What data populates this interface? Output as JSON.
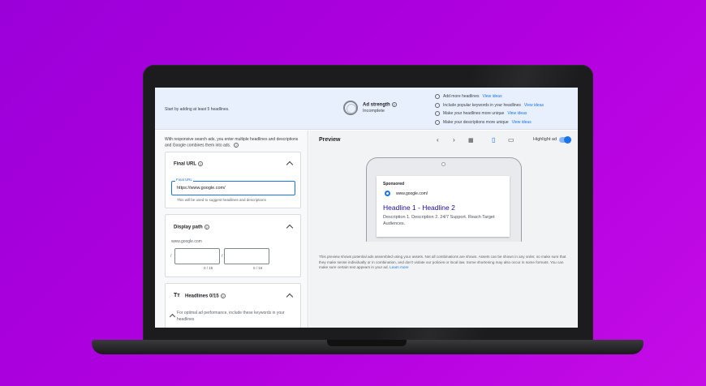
{
  "top_bar": {
    "hint": "Start by adding at least 5 headlines.",
    "ad_strength_title": "Ad strength",
    "ad_strength_status": "Incomplete",
    "suggestions": [
      {
        "text": "Add more headlines",
        "link": "View ideas"
      },
      {
        "text": "Include popular keywords in your headlines",
        "link": "View ideas"
      },
      {
        "text": "Make your headlines more unique",
        "link": "View ideas"
      },
      {
        "text": "Make your descriptions more unique",
        "link": "View ideas"
      }
    ]
  },
  "left": {
    "intro": "With responsive search ads, you enter multiple headlines and descriptions and Google combines them into ads.",
    "final_url": {
      "title": "Final URL",
      "label": "Final URL",
      "value": "https://www.google.com/",
      "help": "This will be used to suggest headlines and descriptions"
    },
    "display_path": {
      "title": "Display path",
      "domain": "www.google.com",
      "slash1": "/",
      "slash2": "/",
      "counter1": "0 / 15",
      "counter2": "0 / 15"
    },
    "headlines": {
      "icon": "Tт",
      "title": "Headlines 0/15",
      "tip": "For optimal ad performance, include these keywords in your headlines"
    }
  },
  "preview": {
    "title": "Preview",
    "highlight_label": "Highlight ad",
    "toolbar_icons": {
      "prev": "‹",
      "next": "›",
      "grid": "▦",
      "mobile": "▯",
      "desktop": "▭"
    },
    "ad": {
      "sponsored": "Sponsored",
      "url": "www.google.com/",
      "headline": "Headline 1 - Headline 2",
      "description": "Description 1. Description 2. 24/7 Support. Reach Target Audiences."
    },
    "disclaimer": "This preview shows potential ads assembled using your assets. Not all combinations are shown. Assets can be shown in any order, so make sure that they make sense individually or in combination, and don't violate our policies or local law. Some shortening may also occur in some formats. You can make sure certain text appears in your ad.",
    "learn_more": "Learn more"
  },
  "colors": {
    "background": "#b300e0",
    "accent": "#1a73e8",
    "headline": "#1a0dab"
  }
}
